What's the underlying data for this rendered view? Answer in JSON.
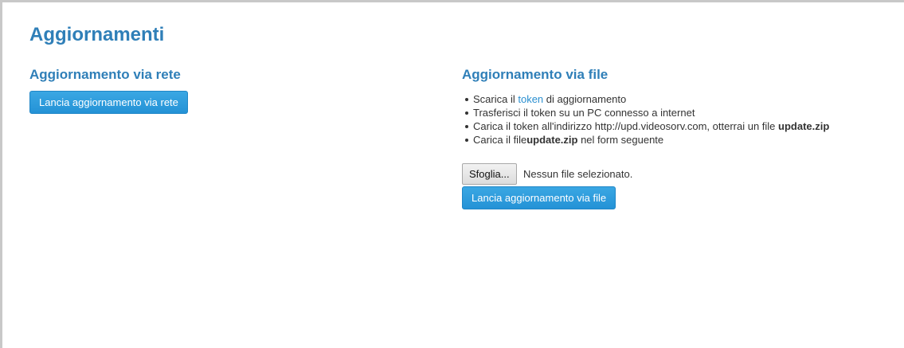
{
  "page": {
    "title": "Aggiornamenti"
  },
  "network": {
    "heading": "Aggiornamento via rete",
    "button_label": "Lancia aggiornamento via rete"
  },
  "file": {
    "heading": "Aggiornamento via file",
    "steps": [
      {
        "pre": "Scarica il ",
        "link": "token",
        "post": " di aggiornamento"
      },
      {
        "text": "Trasferisci il token su un PC connesso a internet"
      },
      {
        "pre": "Carica il token all'indirizzo http://upd.videosorv.com, otterrai un file ",
        "bold": "update.zip"
      },
      {
        "pre": "Carica il file",
        "bold": "update.zip",
        "post": " nel form seguente"
      }
    ],
    "browse_label": "Sfoglia...",
    "no_file_text": "Nessun file selezionato.",
    "button_label": "Lancia aggiornamento via file"
  },
  "colors": {
    "heading": "#2f7fb8",
    "button": "#2492d6",
    "link": "#2a8fd0"
  }
}
